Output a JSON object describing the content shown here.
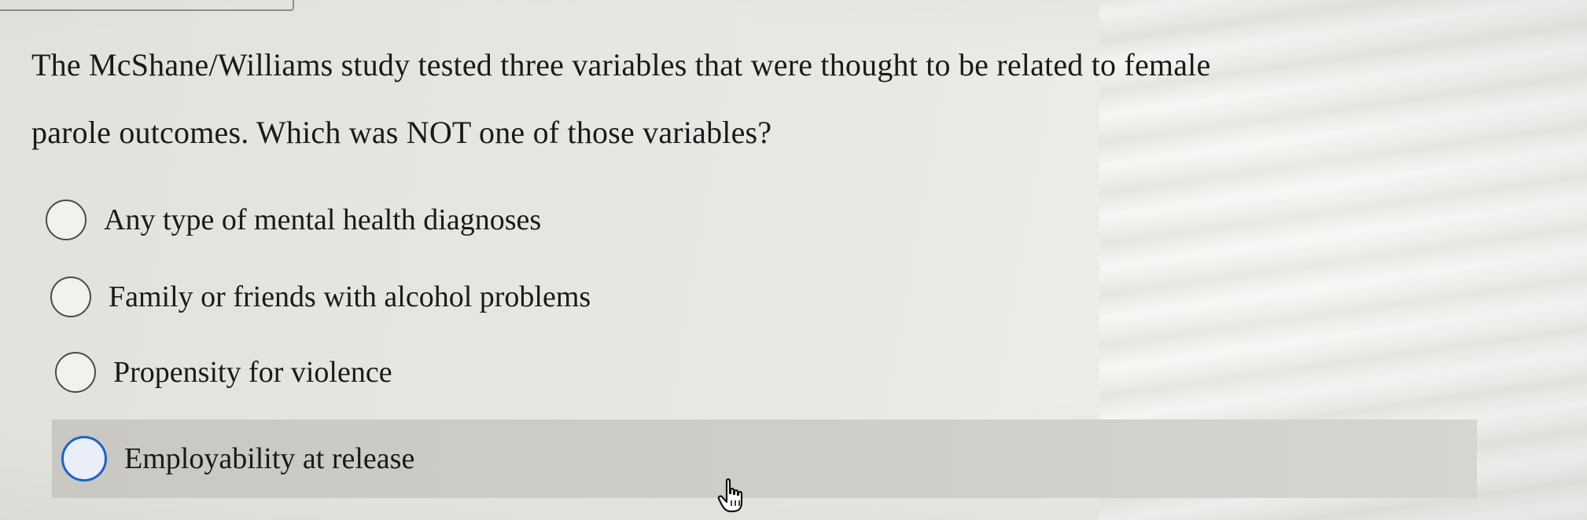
{
  "question": {
    "line1": "The McShane/Williams study tested three variables that were thought to be related to female",
    "line2": "parole outcomes.  Which was NOT one of those variables?"
  },
  "options": [
    {
      "label": "Any type of mental health diagnoses",
      "selected": false
    },
    {
      "label": "Family or friends with alcohol problems",
      "selected": false
    },
    {
      "label": "Propensity for violence",
      "selected": false
    },
    {
      "label": "Employability at release",
      "selected": false,
      "hovered": true
    }
  ],
  "icons": {
    "radio": "radio-button-icon",
    "cursor": "hand-pointer-icon"
  },
  "colors": {
    "hover_highlight": "#cbcac5",
    "focus_ring": "#1f62c9"
  }
}
